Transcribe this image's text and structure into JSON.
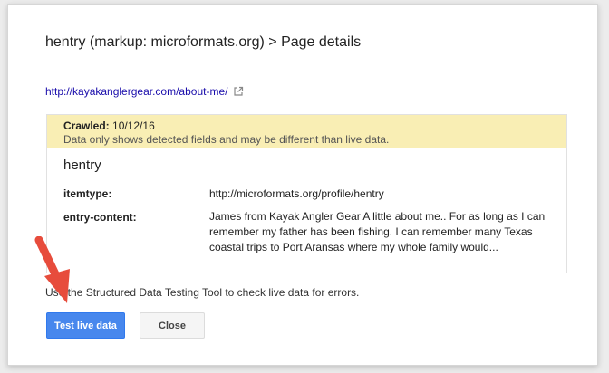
{
  "dialog": {
    "title": "hentry (markup: microformats.org) > Page details",
    "url": "http://kayakanglergear.com/about-me/",
    "external_link_icon": "external-link-icon"
  },
  "notice": {
    "crawled_label": "Crawled:",
    "crawled_date": "10/12/16",
    "message": "Data only shows detected fields and may be different than live data."
  },
  "item": {
    "title": "hentry",
    "fields": [
      {
        "label": "itemtype:",
        "value": "http://microformats.org/profile/hentry"
      },
      {
        "label": "entry-content:",
        "value": "James from Kayak Angler Gear A little about me.. For as long as I can remember my father has been fishing. I can remember many Texas coastal trips to Port Aransas where my whole family would..."
      }
    ]
  },
  "helper_text": "Use the Structured Data Testing Tool to check live data for errors.",
  "buttons": {
    "test_live": "Test live data",
    "close": "Close"
  },
  "colors": {
    "primary_button": "#4787ed",
    "notice_background": "#f9eeb4",
    "link": "#1a0dab",
    "annotation_arrow": "#e74c3c"
  }
}
